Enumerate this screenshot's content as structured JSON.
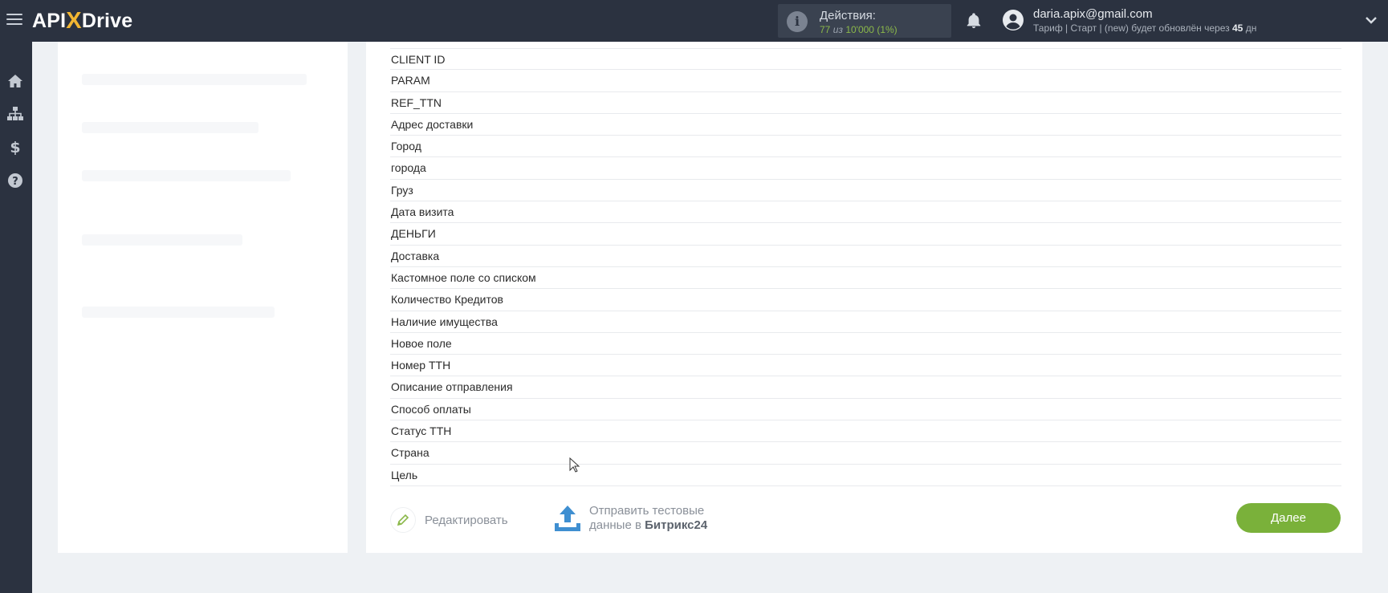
{
  "header": {
    "logo_prefix": "API",
    "logo_x": "X",
    "logo_suffix": "Drive",
    "actions_label": "Действия:",
    "actions_used": "77",
    "actions_of": "из",
    "actions_total": "10'000",
    "actions_percent": "(1%)",
    "user_email": "daria.apix@gmail.com",
    "plan_text": "Тариф | Старт | (new) будет обновлён через",
    "plan_days": "45",
    "plan_days_unit": "дн"
  },
  "nav": {
    "icons": [
      "home-icon",
      "sitemap-icon",
      "dollar-icon",
      "help-icon"
    ]
  },
  "fields": [
    "CLIENT ID",
    "PARAM",
    "REF_TTN",
    "Адрес доставки",
    "Город",
    "города",
    "Груз",
    "Дата визита",
    "ДЕНЬГИ",
    "Доставка",
    "Кастомное поле со списком",
    "Количество Кредитов",
    "Наличие имущества",
    "Новое поле",
    "Номер ТТН",
    "Описание отправления",
    "Способ оплаты",
    "Статус ТТН",
    "Страна",
    "Цель"
  ],
  "footer": {
    "edit_label": "Редактировать",
    "send_line1": "Отправить тестовые",
    "send_line2_prefix": "данные в",
    "send_target": "Битрикс24",
    "next_label": "Далее"
  },
  "colors": {
    "topbar": "#2b3240",
    "accent_green": "#7ab13a",
    "logo_x": "#f2b632",
    "upload_blue": "#3f8fd1"
  }
}
